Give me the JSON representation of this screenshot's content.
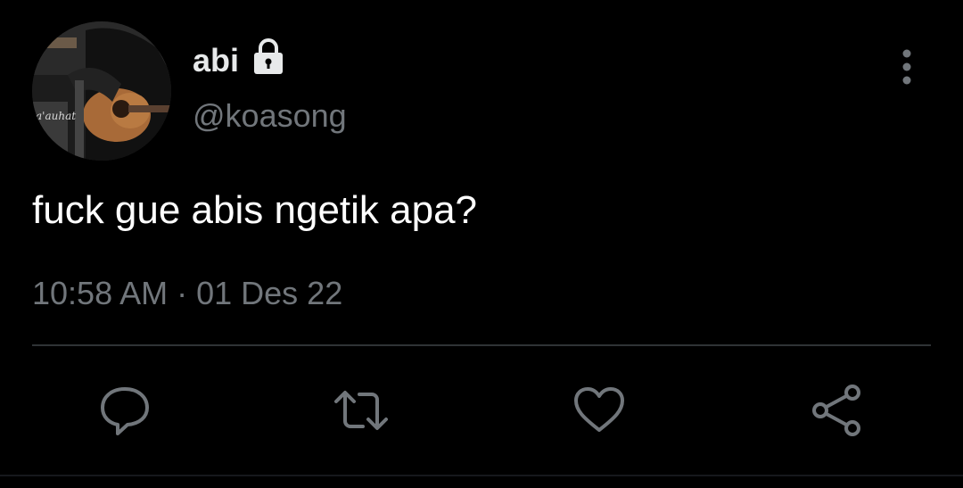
{
  "author": {
    "display_name": "abi",
    "handle": "@koasong",
    "verified_icon": "lock-icon",
    "avatar_description_icon": "avatar-guitarist"
  },
  "tweet": {
    "text": "fuck gue abis ngetik apa?",
    "time": "10:58 AM",
    "separator": "·",
    "date": "01 Des 22"
  },
  "actions": [
    {
      "name": "reply",
      "icon": "speech-bubble-icon"
    },
    {
      "name": "retweet",
      "icon": "retweet-icon"
    },
    {
      "name": "like",
      "icon": "heart-icon"
    },
    {
      "name": "share",
      "icon": "share-icon"
    }
  ],
  "colors": {
    "background": "#000000",
    "primary_text": "#e7e9ea",
    "secondary_text": "#71767b",
    "divider": "#2f3336",
    "icon": "#71767b"
  }
}
